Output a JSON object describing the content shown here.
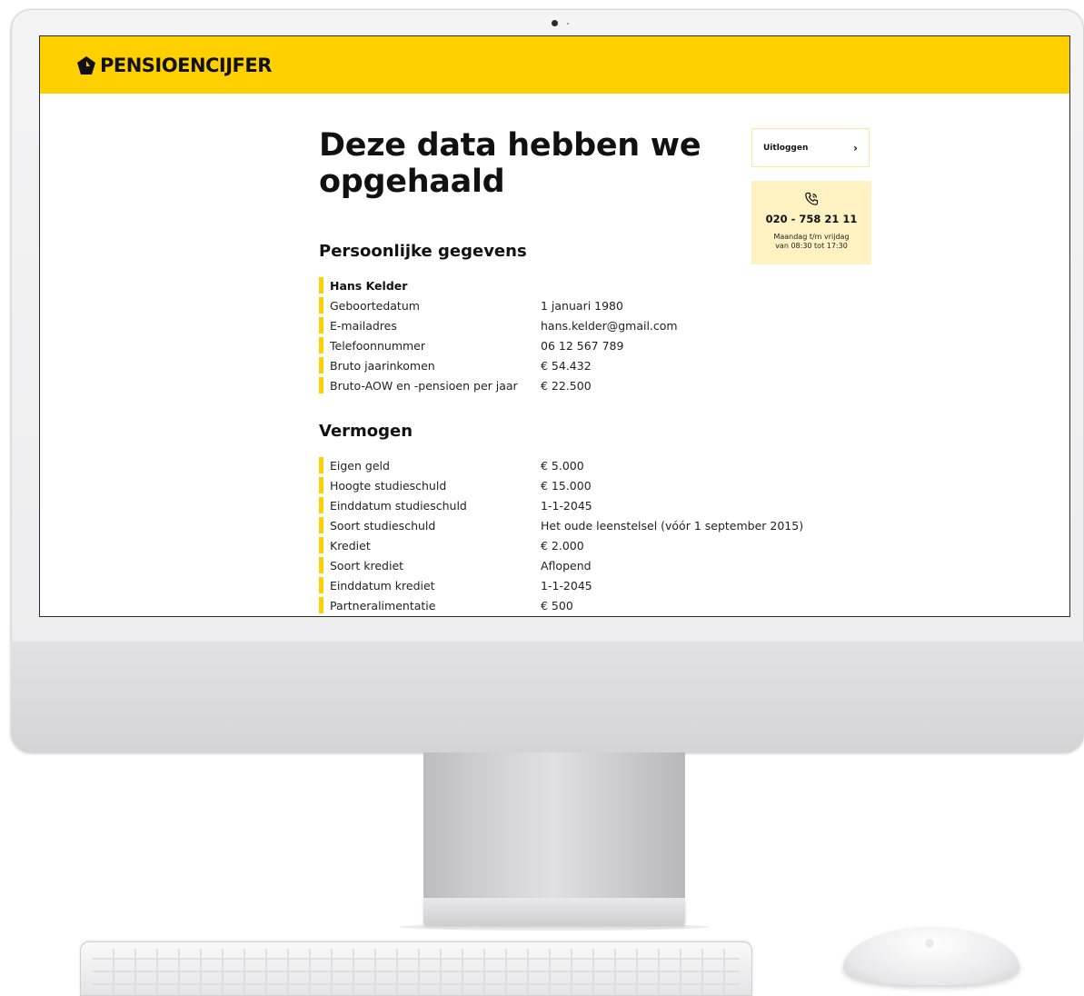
{
  "brand": {
    "name": "PENSIOENCIJFER",
    "color": "#ffd000"
  },
  "page": {
    "title": "Deze data hebben we opgehaald"
  },
  "sidebar": {
    "logout_label": "Uitloggen",
    "phone": "020 - 758 21 11",
    "hours_line1": "Maandag t/m vrijdag",
    "hours_line2": "van 08:30 tot 17:30"
  },
  "personal": {
    "title": "Persoonlijke gegevens",
    "name": "Hans Kelder",
    "rows": [
      {
        "label": "Geboortedatum",
        "value": "1 januari 1980"
      },
      {
        "label": "E-mailadres",
        "value": "hans.kelder@gmail.com"
      },
      {
        "label": "Telefoonnummer",
        "value": "06 12 567 789"
      },
      {
        "label": "Bruto jaarinkomen",
        "value": "€ 54.432"
      },
      {
        "label": "Bruto-AOW en -pensioen per jaar",
        "value": "€ 22.500"
      }
    ]
  },
  "assets": {
    "title": "Vermogen",
    "rows": [
      {
        "label": "Eigen geld",
        "value": "€ 5.000"
      },
      {
        "label": "Hoogte studieschuld",
        "value": "€ 15.000"
      },
      {
        "label": "Einddatum studieschuld",
        "value": "1-1-2045"
      },
      {
        "label": "Soort studieschuld",
        "value": "Het oude leenstelsel (vóór 1 september 2015)"
      },
      {
        "label": "Krediet",
        "value": "€ 2.000"
      },
      {
        "label": "Soort krediet",
        "value": "Aflopend"
      },
      {
        "label": "Einddatum krediet",
        "value": "1-1-2045"
      },
      {
        "label": "Partneralimentatie",
        "value": "€ 500"
      }
    ]
  }
}
